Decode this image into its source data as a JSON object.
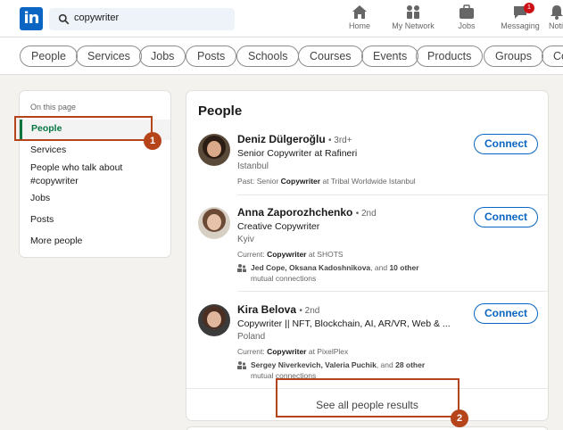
{
  "topbar": {
    "search_value": "copywriter",
    "nav": [
      {
        "label": "Home",
        "icon": "home-icon"
      },
      {
        "label": "My Network",
        "icon": "network-icon"
      },
      {
        "label": "Jobs",
        "icon": "jobs-icon"
      },
      {
        "label": "Messaging",
        "icon": "messaging-icon",
        "badge": "1"
      },
      {
        "label": "Noti",
        "icon": "notifications-icon"
      }
    ]
  },
  "filters": [
    "People",
    "Services",
    "Jobs",
    "Posts",
    "Schools",
    "Courses",
    "Events",
    "Products",
    "Groups",
    "Co"
  ],
  "sidebar": {
    "title": "On this page",
    "items": [
      "People",
      "Services",
      "People who talk about #copywriter",
      "Jobs",
      "Posts",
      "More people"
    ]
  },
  "main": {
    "title": "People",
    "people": [
      {
        "name": "Deniz Dülgeroğlu",
        "degree": "• 3rd+",
        "title": "Senior Copywriter at Rafineri",
        "location": "Istanbul",
        "extra_prefix": "Past: Senior ",
        "extra_bold": "Copywriter",
        "extra_suffix": " at Tribal Worldwide Istanbul",
        "button": "Connect"
      },
      {
        "name": "Anna Zaporozhchenko",
        "degree": "• 2nd",
        "title": "Creative Copywriter",
        "location": "Kyiv",
        "extra_prefix": "Current: ",
        "extra_bold": "Copywriter",
        "extra_suffix": " at SHOTS",
        "mutual_bold": "Jed Cope, Oksana Kadoshnikova",
        "mutual_mid": ", and ",
        "mutual_bold2": "10 other",
        "mutual_end": "mutual connections",
        "button": "Connect"
      },
      {
        "name": "Kira Belova",
        "degree": "• 2nd",
        "title": "Copywriter || NFT, Blockchain, AI, AR/VR, Web & ...",
        "location": "Poland",
        "extra_prefix": "Current: ",
        "extra_bold": "Copywriter",
        "extra_suffix": " at PixelPlex",
        "mutual_bold": "Sergey Niverkevich, Valeria Puchik",
        "mutual_mid": ", and ",
        "mutual_bold2": "28 other",
        "mutual_end": "mutual connections",
        "button": "Connect"
      }
    ],
    "see_all": "See all people results"
  },
  "annotations": {
    "marker1": "1",
    "marker2": "2"
  },
  "colors": {
    "brand": "#0a66c2",
    "active": "#057642",
    "annotation": "#b5441b"
  }
}
